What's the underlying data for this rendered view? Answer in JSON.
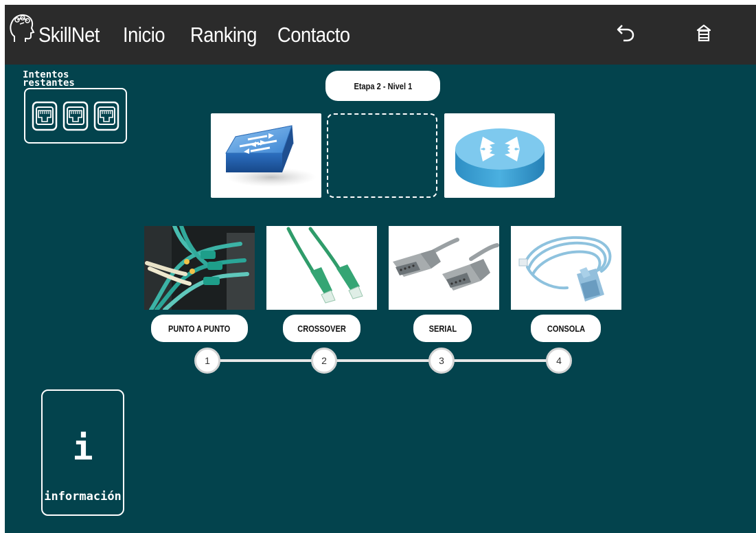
{
  "nav": {
    "brand": "SkillNet",
    "links": [
      "Inicio",
      "Ranking",
      "Contacto"
    ],
    "icons": [
      "back-arrow-icon",
      "exit-icon"
    ]
  },
  "attempts": {
    "label": "Intentos restantes",
    "remaining": 3,
    "icon": "ethernet-port-icon"
  },
  "stage": {
    "label": "Etapa 2 - Nivel 1"
  },
  "topology": {
    "left_device": "switch-icon",
    "right_device": "router-icon"
  },
  "cables": [
    {
      "label": "PUNTO A PUNTO",
      "step": "1",
      "image": "fiber-cables-photo"
    },
    {
      "label": "CROSSOVER",
      "step": "2",
      "image": "ethernet-cable-photo"
    },
    {
      "label": "SERIAL",
      "step": "3",
      "image": "serial-cable-photo"
    },
    {
      "label": "CONSOLA",
      "step": "4",
      "image": "console-cable-photo"
    }
  ],
  "info": {
    "glyph": "i",
    "label": "información"
  },
  "colors": {
    "background": "#03434d",
    "navbar": "#2b2b2b",
    "cable_green": "#2e9c6e",
    "console_blue": "#8ec2de"
  }
}
